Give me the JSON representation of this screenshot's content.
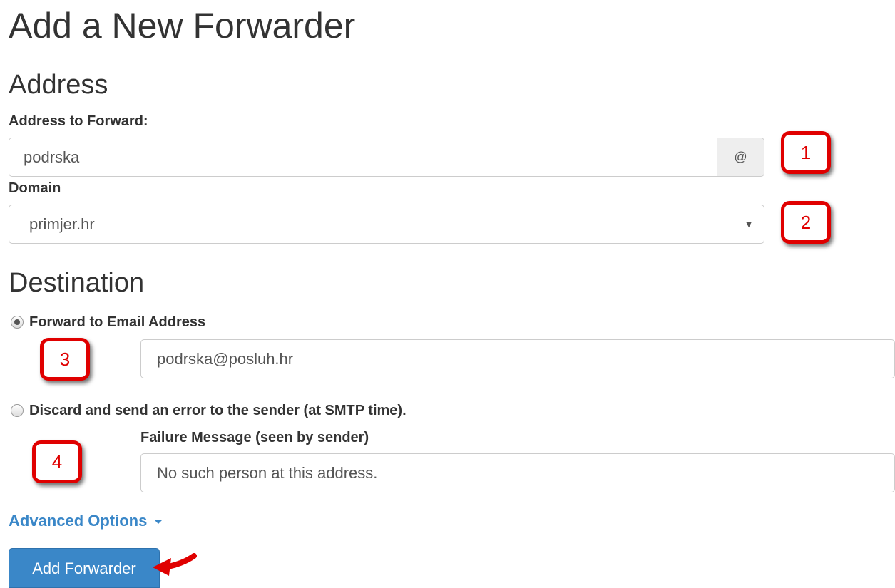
{
  "page": {
    "title": "Add a New Forwarder"
  },
  "address": {
    "heading": "Address",
    "forward_label": "Address to Forward:",
    "forward_value": "podrska",
    "at_symbol": "@",
    "domain_label": "Domain",
    "domain_value": "primjer.hr",
    "caret": "▼"
  },
  "destination": {
    "heading": "Destination",
    "option_forward_label": "Forward to Email Address",
    "forward_email_value": "podrska@posluh.hr",
    "option_discard_label": "Discard and send an error to the sender (at SMTP time).",
    "failure_label": "Failure Message (seen by sender)",
    "failure_value": "No such person at this address."
  },
  "advanced": {
    "label": "Advanced Options"
  },
  "actions": {
    "submit_label": "Add Forwarder"
  },
  "annotations": {
    "badge_1": "1",
    "badge_2": "2",
    "badge_3": "3",
    "badge_4": "4",
    "color": "#e00000"
  },
  "colors": {
    "primary": "#3a87c8",
    "text": "#333333",
    "border": "#cccccc"
  }
}
